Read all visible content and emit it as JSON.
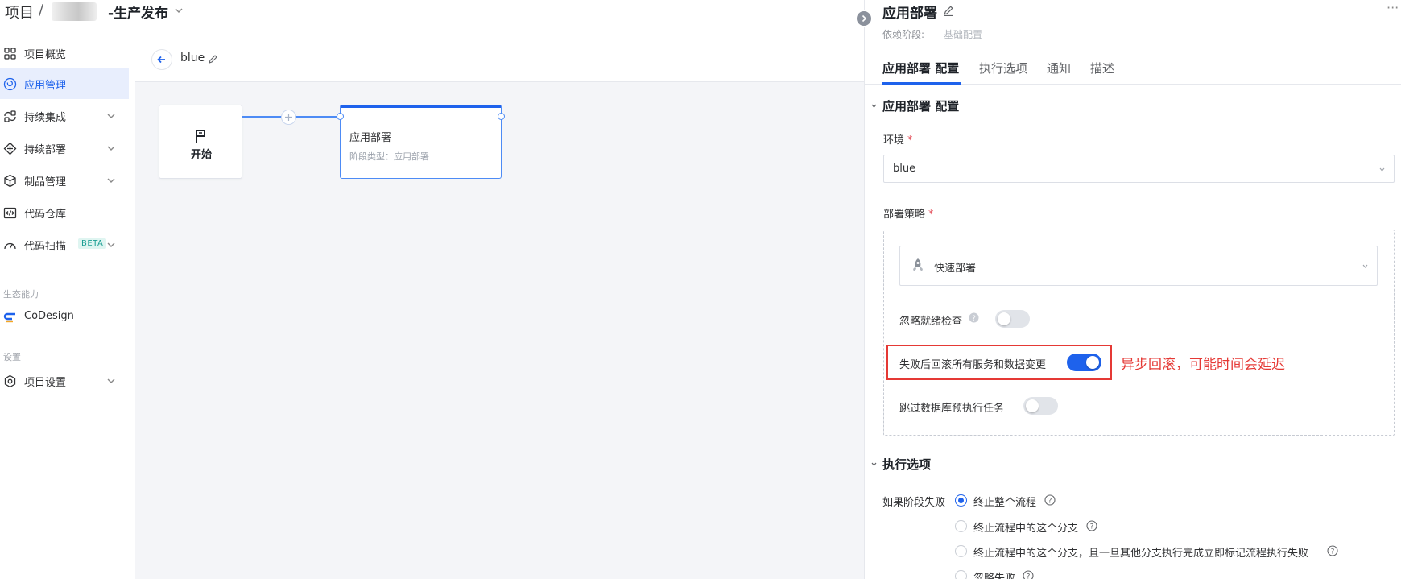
{
  "breadcrumb": {
    "root": "项目",
    "separator": "/",
    "project": "-生产发布"
  },
  "sidebar": {
    "items": [
      {
        "label": "项目概览"
      },
      {
        "label": "应用管理"
      },
      {
        "label": "持续集成"
      },
      {
        "label": "持续部署"
      },
      {
        "label": "制品管理"
      },
      {
        "label": "代码仓库"
      },
      {
        "label": "代码扫描",
        "badge": "BETA"
      }
    ],
    "group_ecosystem": "生态能力",
    "codesign": "CoDesign",
    "group_settings": "设置",
    "settings_item": "项目设置"
  },
  "canvas": {
    "stage_name": "blue",
    "start_label": "开始",
    "node": {
      "title": "应用部署",
      "subtitle": "阶段类型：应用部署"
    }
  },
  "panel": {
    "title": "应用部署",
    "dependency_label": "依赖阶段:",
    "dependency_value": "基础配置",
    "more": "···",
    "tabs": [
      "应用部署 配置",
      "执行选项",
      "通知",
      "描述"
    ],
    "config_section": "应用部署 配置",
    "env_label": "环境",
    "env_required": "*",
    "env_value": "blue",
    "strategy_label": "部署策略",
    "strategy_required": "*",
    "strategy_value": "快速部署",
    "toggles": [
      {
        "label": "忽略就绪检查",
        "on": false
      },
      {
        "label": "失败后回滚所有服务和数据变更",
        "on": true
      },
      {
        "label": "跳过数据库预执行任务",
        "on": false
      }
    ],
    "annotation": "异步回滚，可能时间会延迟",
    "exec_section": "执行选项",
    "fail_label": "如果阶段失败",
    "fail_options": [
      {
        "label": "终止整个流程",
        "checked": true
      },
      {
        "label": "终止流程中的这个分支",
        "checked": false
      },
      {
        "label": "终止流程中的这个分支，且一旦其他分支执行完成立即标记流程执行失败",
        "checked": false
      },
      {
        "label": "忽略失败",
        "checked": false
      }
    ]
  },
  "colors": {
    "accent": "#1e62ec",
    "annotation": "#e53935",
    "canvas_bg": "#f4f5f8"
  }
}
